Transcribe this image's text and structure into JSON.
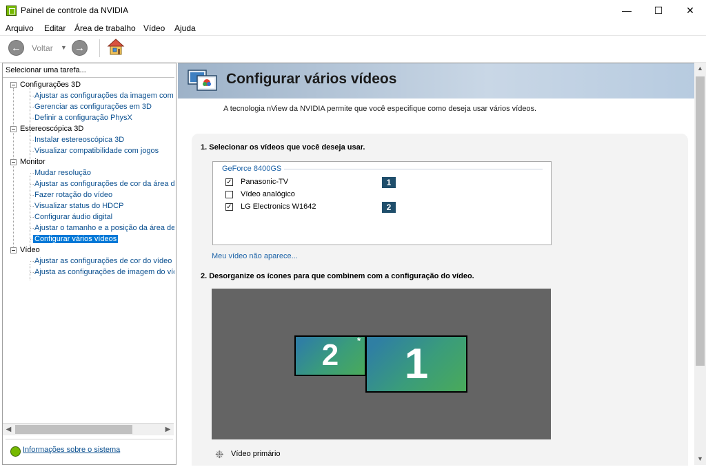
{
  "window": {
    "title": "Painel de controle da NVIDIA",
    "minimize": "—",
    "maximize": "☐",
    "close": "✕"
  },
  "menu": [
    "Arquivo",
    "Editar",
    "Área de trabalho",
    "Vídeo",
    "Ajuda"
  ],
  "toolbar": {
    "back_label": "Voltar",
    "back_icon": "arrow-left-icon",
    "forward_icon": "arrow-right-icon",
    "home_icon": "home-icon"
  },
  "sidebar": {
    "header": "Selecionar uma tarefa...",
    "tree": [
      {
        "label": "Configurações 3D",
        "children": [
          "Ajustar as configurações da imagem com a",
          "Gerenciar as configurações em 3D",
          "Definir a configuração PhysX"
        ]
      },
      {
        "label": "Estereoscópica 3D",
        "children": [
          "Instalar estereoscópica 3D",
          "Visualizar compatibilidade com jogos"
        ]
      },
      {
        "label": "Monitor",
        "children": [
          "Mudar resolução",
          "Ajustar as configurações de cor da área de",
          "Fazer rotação do vídeo",
          "Visualizar status do HDCP",
          "Configurar áudio digital",
          "Ajustar o tamanho e a posição da área de t",
          "Configurar vários vídeos"
        ]
      },
      {
        "label": "Vídeo",
        "children": [
          "Ajustar as configurações de cor do vídeo",
          "Ajusta as configurações de imagem do víde"
        ]
      }
    ],
    "selected": "Configurar vários vídeos",
    "sysinfo_link": "Informações sobre o sistema"
  },
  "main": {
    "title": "Configurar vários vídeos",
    "description": "A tecnologia nView da NVIDIA permite que você especifique como deseja usar vários vídeos.",
    "section1": "1. Selecionar os vídeos que você deseja usar.",
    "gpu_name": "GeForce 8400GS",
    "displays": [
      {
        "label": "Panasonic-TV",
        "checked": true,
        "badge": "1"
      },
      {
        "label": "Vídeo analógico",
        "checked": false,
        "badge": ""
      },
      {
        "label": "LG Electronics W1642",
        "checked": true,
        "badge": "2"
      }
    ],
    "missing_link": "Meu vídeo não aparece...",
    "section2": "2. Desorganize os ícones para que combinem com a configuração do vídeo.",
    "monitors": [
      {
        "number": "2",
        "primary": true
      },
      {
        "number": "1",
        "primary": false
      }
    ],
    "primary_star": "*",
    "primary_label": "Vídeo primário"
  },
  "colors": {
    "accent": "#0078d7",
    "link": "#1e64a8",
    "nvidia_green": "#76b900",
    "arrange_bg": "#646464"
  }
}
